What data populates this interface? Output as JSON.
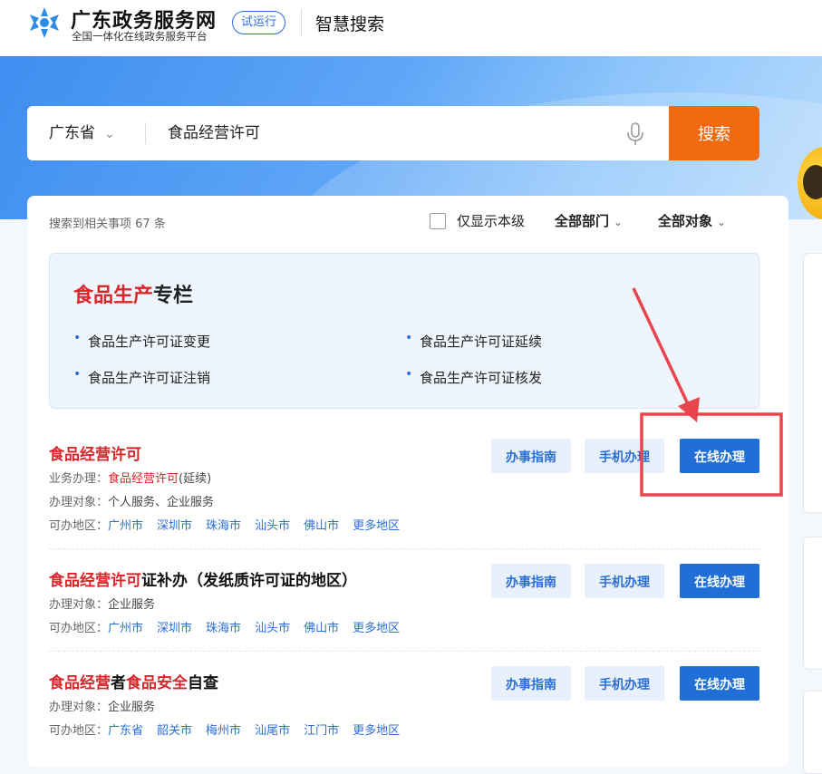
{
  "header": {
    "brand": "广东政务服务网",
    "brand_sub": "全国一体化在线政务服务平台",
    "trial_badge": "试运行",
    "title": "智慧搜索"
  },
  "search": {
    "region": "广东省",
    "query": "食品经营许可",
    "button": "搜索"
  },
  "filters": {
    "result_count": "搜索到相关事项 67 条",
    "local_only_label": "仅显示本级",
    "department": "全部部门",
    "target": "全部对象"
  },
  "column": {
    "title_red": "食品生产",
    "title_rest": "专栏",
    "items": [
      "食品生产许可证变更",
      "食品生产许可证延续",
      "食品生产许可证注销",
      "食品生产许可证核发"
    ]
  },
  "labels": {
    "business": "业务办理：",
    "target": "办理对象：",
    "region": "可办地区：",
    "guide_btn": "办事指南",
    "mobile_btn": "手机办理",
    "online_btn": "在线办理"
  },
  "results": [
    {
      "title_red": "食品经营许可",
      "title_rest": "",
      "business_red": "食品经营许可",
      "business_rest": "(延续)",
      "target": "个人服务、企业服务",
      "cities": [
        "广州市",
        "深圳市",
        "珠海市",
        "汕头市",
        "佛山市",
        "更多地区"
      ]
    },
    {
      "title_red": "食品经营许可",
      "title_rest": "证补办（发纸质许可证的地区）",
      "target": "企业服务",
      "cities": [
        "广州市",
        "深圳市",
        "珠海市",
        "汕头市",
        "佛山市",
        "更多地区"
      ]
    },
    {
      "title_parts": [
        {
          "text": "食品经营",
          "red": true
        },
        {
          "text": "者",
          "red": false
        },
        {
          "text": "食品安全",
          "red": true
        },
        {
          "text": "自查",
          "red": false
        }
      ],
      "target": "企业服务",
      "cities": [
        "广东省",
        "韶关市",
        "梅州市",
        "汕尾市",
        "江门市",
        "更多地区"
      ]
    }
  ],
  "colors": {
    "primary": "#1f6fd6",
    "search_button": "#ee6b12",
    "highlight": "#d9262b",
    "annotation": "#e8454d"
  }
}
